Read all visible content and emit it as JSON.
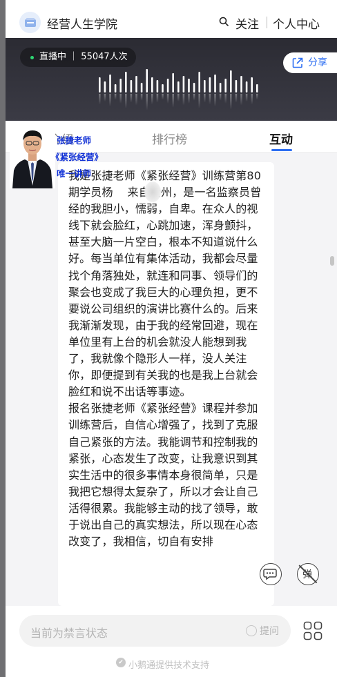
{
  "header": {
    "school_name": "经营人生学院",
    "follow_label": "关注",
    "center_label": "个人中心"
  },
  "live": {
    "status": "直播中",
    "viewers": "55047人次",
    "share_label": "分享"
  },
  "tabs": [
    {
      "label": "介绍"
    },
    {
      "label": "排行榜"
    },
    {
      "label": "互动"
    }
  ],
  "overlay": {
    "name": "张捷老师",
    "course": "《紧张经营》",
    "title": "唯一讲师"
  },
  "message": {
    "text": "我是张捷老师《紧张经营》训练营第80期学员杨    来自贵州，是一名监察员曾经的我胆小，懦弱，自卑。在众人的视线下就会脸红，心跳加速，浑身颤抖，甚至大脑一片空白，根本不知道说什么好。每当单位有集体活动，我都会尽量找个角落独处，就连和同事、领导们的聚会也变成了我巨大的心理负担，更不要说公司组织的演讲比赛什么的。后来我渐渐发现，由于我的经常回避，现在单位里有上台的机会就没人能想到我了，我就像个隐形人一样，没人关注你，即便提到有关我的也是我上台就会脸红和说不出话等事迹。\n报名张捷老师《紧张经营》课程并参加训练营后，自信心增强了，找到了克服自己紧张的方法。我能调节和控制我的紧张，心态发生了改变，让我意识到其实生活中的很多事情本身很简单，只是我把它想得太复杂了，所以才会让自己活得很累。我能够主动的找了领导，敢于说出自己的真实想法，所以现在心态改变了，我相信，切自有安排"
  },
  "floating": {
    "barrage_label": "弹"
  },
  "bottom": {
    "input_placeholder": "当前为禁言状态",
    "ask_label": "提问",
    "powered_by": "小鹅通提供技术支持"
  },
  "colors": {
    "accent": "#2c6ef2",
    "overlay_text": "#1030d6",
    "live_dot": "#2ed573"
  }
}
